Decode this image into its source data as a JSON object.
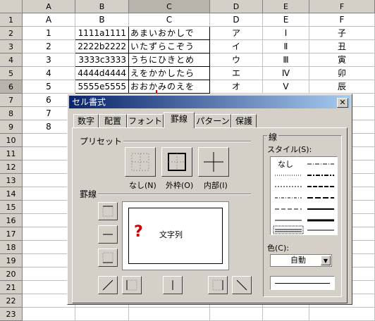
{
  "columns": [
    "A",
    "B",
    "C",
    "D",
    "E",
    "F"
  ],
  "rows": [
    "1",
    "2",
    "3",
    "4",
    "5",
    "6",
    "7",
    "8",
    "9",
    "10",
    "11",
    "12",
    "13",
    "14",
    "15",
    "16",
    "17",
    "18",
    "19",
    "20",
    "21",
    "22",
    "23"
  ],
  "header_row": [
    "A",
    "B",
    "C",
    "D",
    "E",
    "F"
  ],
  "data_rows": [
    [
      "1",
      "1111a1111",
      "あまいおかしで",
      "ア",
      "Ⅰ",
      "子"
    ],
    [
      "2",
      "2222b2222",
      "いたずらこぞう",
      "イ",
      "Ⅱ",
      "丑"
    ],
    [
      "3",
      "3333c3333",
      "うちにひきとめ",
      "ウ",
      "Ⅲ",
      "寅"
    ],
    [
      "4",
      "4444d4444",
      "えをかかしたら",
      "エ",
      "Ⅳ",
      "卯"
    ],
    [
      "5",
      "5555e5555",
      "おおかみのえを",
      "オ",
      "Ⅴ",
      "辰"
    ]
  ],
  "extra_a": [
    "6",
    "7",
    "8"
  ],
  "dialog": {
    "title": "セル書式",
    "close": "✕",
    "tabs": [
      "数字",
      "配置",
      "フォント",
      "罫線",
      "パターン",
      "保護"
    ],
    "preset_label": "プリセット",
    "preset_buttons": [
      "なし(N)",
      "外枠(O)",
      "内部(I)"
    ],
    "border_label": "罫線",
    "preview_text": "文字列",
    "preview_mark": "?",
    "line_label": "線",
    "style_label": "スタイル(S):",
    "style_none": "なし",
    "color_label": "色(C):",
    "color_value": "自動"
  },
  "colors": {
    "header_bg": "#d4d0c8",
    "title_start": "#0a246a",
    "arrow": "#e00000",
    "mark": "#cc0000"
  }
}
